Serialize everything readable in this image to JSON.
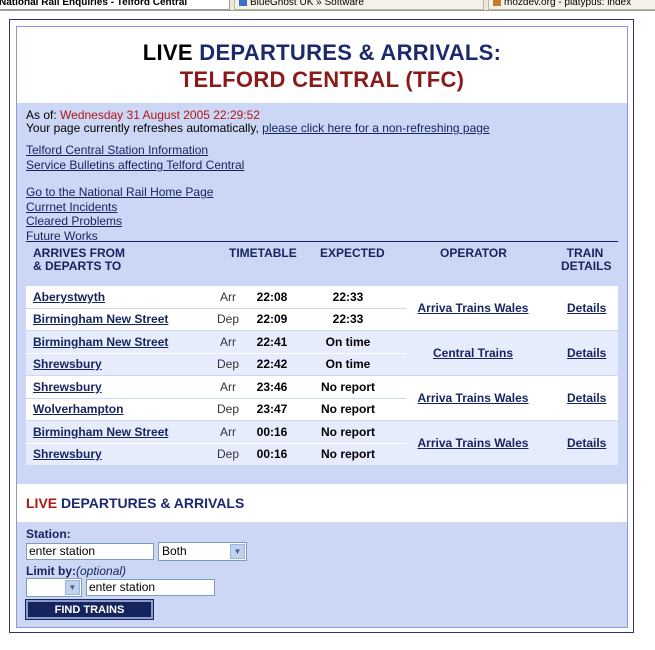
{
  "browser": {
    "tabs": [
      {
        "label": "National Rail Enquiries - Telford Central"
      },
      {
        "label": "BlueGhost UK » Software"
      },
      {
        "label": "mozdev.org - platypus: index"
      }
    ]
  },
  "header": {
    "line1_live": "LIVE",
    "line1_rest": "DEPARTURES & ARRIVALS:",
    "line2": "TELFORD CENTRAL (TFC)"
  },
  "info": {
    "as_of_label": "As of:",
    "as_of_value": "Wednesday 31 August 2005 22:29:52",
    "refresh_text": "Your page currently refreshes automatically,",
    "refresh_link": "please click here for a non-refreshing page"
  },
  "links_group1": [
    "Telford Central Station Information",
    "Service Bulletins affecting Telford Central"
  ],
  "links_group2": [
    "Go to the National Rail Home Page",
    "Currnet Incidents",
    "Cleared Problems",
    "Future Works"
  ],
  "table": {
    "headers": {
      "from_line1": "ARRIVES FROM",
      "from_line2": "& DEPARTS TO",
      "timetable": "TIMETABLE",
      "expected": "EXPECTED",
      "operator": "OPERATOR",
      "details_line1": "TRAIN",
      "details_line2": "DETAILS"
    },
    "groups": [
      {
        "operator": "Arriva Trains Wales",
        "details": "Details",
        "rows": [
          {
            "station": "Aberystwyth",
            "type": "Arr",
            "time": "22:08",
            "expected": "22:33"
          },
          {
            "station": "Birmingham New Street",
            "type": "Dep",
            "time": "22:09",
            "expected": "22:33"
          }
        ]
      },
      {
        "operator": "Central Trains",
        "details": "Details",
        "rows": [
          {
            "station": "Birmingham New Street",
            "type": "Arr",
            "time": "22:41",
            "expected": "On time"
          },
          {
            "station": "Shrewsbury",
            "type": "Dep",
            "time": "22:42",
            "expected": "On time"
          }
        ]
      },
      {
        "operator": "Arriva Trains Wales",
        "details": "Details",
        "rows": [
          {
            "station": "Shrewsbury",
            "type": "Arr",
            "time": "23:46",
            "expected": "No report"
          },
          {
            "station": "Wolverhampton",
            "type": "Dep",
            "time": "23:47",
            "expected": "No report"
          }
        ]
      },
      {
        "operator": "Arriva Trains Wales",
        "details": "Details",
        "rows": [
          {
            "station": "Birmingham New Street",
            "type": "Arr",
            "time": "00:16",
            "expected": "No report"
          },
          {
            "station": "Shrewsbury",
            "type": "Dep",
            "time": "00:16",
            "expected": "No report"
          }
        ]
      }
    ]
  },
  "search": {
    "title_live": "LIVE",
    "title_rest": "DEPARTURES & ARRIVALS",
    "station_label": "Station:",
    "station_value": "enter station",
    "direction_value": "Both",
    "limit_label": "Limit by:",
    "limit_optional": "(optional)",
    "limit_select_value": "",
    "limit_station_value": "enter station",
    "button_label": "FIND TRAINS"
  },
  "colors": {
    "navy": "#16245e",
    "red": "#b01818",
    "panel": "#ccd6f5"
  }
}
